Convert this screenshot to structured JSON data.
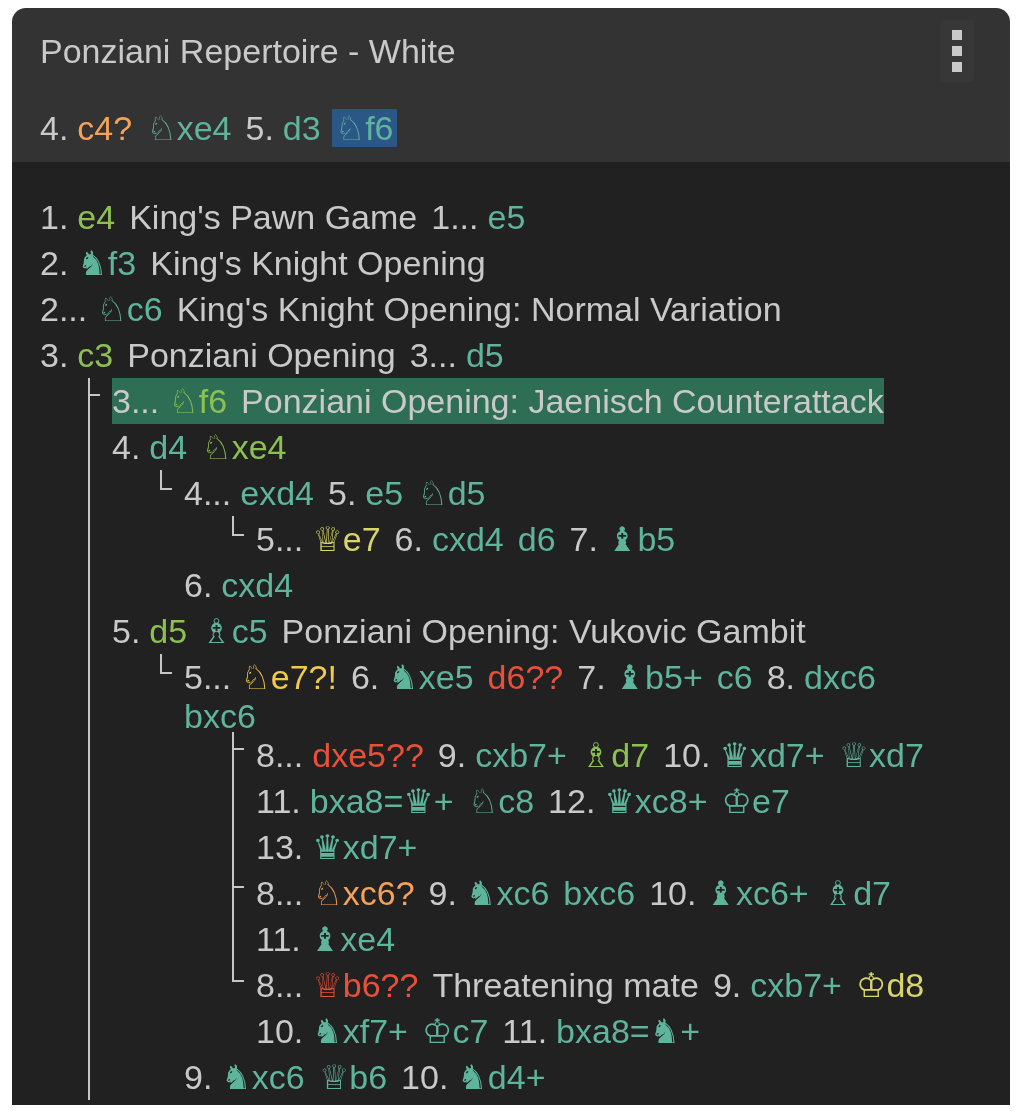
{
  "panel": {
    "title": "Ponziani Repertoire - White"
  },
  "current_line": [
    {
      "number": "4.",
      "move": "c4?",
      "color": "#f4a259",
      "selected": false
    },
    {
      "move": "♘xe4",
      "color": "#5fb49c",
      "selected": false
    },
    {
      "number": "5.",
      "move": "d3",
      "color": "#5fb49c",
      "selected": false
    },
    {
      "move": "♘f6",
      "color": "#5fb49c",
      "selected": true
    }
  ],
  "tree": {
    "blocks": [
      {
        "kind": "line",
        "selected": false,
        "items": [
          {
            "kind": "move",
            "number": "1.",
            "move": "e4",
            "color": "#8cc152"
          },
          {
            "kind": "opening",
            "text": "King's Pawn Game"
          },
          {
            "kind": "move",
            "number": "1...",
            "move": "e5",
            "color": "#5fb49c"
          }
        ]
      },
      {
        "kind": "line",
        "selected": false,
        "items": [
          {
            "kind": "move",
            "number": "2.",
            "move": "♞f3",
            "color": "#5fb49c"
          },
          {
            "kind": "opening",
            "text": "King's Knight Opening"
          }
        ]
      },
      {
        "kind": "line",
        "selected": false,
        "items": [
          {
            "kind": "move",
            "number": "2...",
            "move": "♘c6",
            "color": "#5fb49c"
          },
          {
            "kind": "opening",
            "text": "King's Knight Opening: Normal Variation"
          }
        ]
      },
      {
        "kind": "line",
        "selected": false,
        "items": [
          {
            "kind": "move",
            "number": "3.",
            "move": "c3",
            "color": "#8cc152"
          },
          {
            "kind": "opening",
            "text": "Ponziani Opening"
          },
          {
            "kind": "move",
            "number": "3...",
            "move": "d5",
            "color": "#5fb49c"
          }
        ]
      },
      {
        "kind": "branches",
        "continues_below": true,
        "variations": [
          {
            "blocks": [
              {
                "kind": "line",
                "selected": true,
                "items": [
                  {
                    "kind": "move",
                    "number": "3...",
                    "move": "♘f6",
                    "color": "#8cc152"
                  },
                  {
                    "kind": "opening",
                    "text": "Ponziani Opening: Jaenisch Counterattack"
                  }
                ]
              },
              {
                "kind": "line",
                "selected": false,
                "items": [
                  {
                    "kind": "move",
                    "number": "4.",
                    "move": "d4",
                    "color": "#5fb49c"
                  },
                  {
                    "kind": "move",
                    "move": "♘xe4",
                    "color": "#8cc152"
                  }
                ]
              },
              {
                "kind": "branches",
                "continues_below": false,
                "variations": [
                  {
                    "blocks": [
                      {
                        "kind": "line",
                        "selected": false,
                        "items": [
                          {
                            "kind": "move",
                            "number": "4...",
                            "move": "exd4",
                            "color": "#5fb49c"
                          },
                          {
                            "kind": "move",
                            "number": "5.",
                            "move": "e5",
                            "color": "#5fb49c"
                          },
                          {
                            "kind": "move",
                            "move": "♘d5",
                            "color": "#5fb49c"
                          }
                        ]
                      },
                      {
                        "kind": "branches",
                        "continues_below": false,
                        "variations": [
                          {
                            "blocks": [
                              {
                                "kind": "line",
                                "selected": false,
                                "items": [
                                  {
                                    "kind": "move",
                                    "number": "5...",
                                    "move": "♕e7",
                                    "color": "#d8d66a"
                                  },
                                  {
                                    "kind": "move",
                                    "number": "6.",
                                    "move": "cxd4",
                                    "color": "#5fb49c"
                                  },
                                  {
                                    "kind": "move",
                                    "move": "d6",
                                    "color": "#5fb49c"
                                  },
                                  {
                                    "kind": "move",
                                    "number": "7.",
                                    "move": "♝b5",
                                    "color": "#5fb49c"
                                  }
                                ]
                              }
                            ]
                          }
                        ]
                      },
                      {
                        "kind": "line",
                        "selected": false,
                        "items": [
                          {
                            "kind": "move",
                            "number": "6.",
                            "move": "cxd4",
                            "color": "#5fb49c"
                          }
                        ]
                      }
                    ]
                  }
                ]
              },
              {
                "kind": "line",
                "selected": false,
                "items": [
                  {
                    "kind": "move",
                    "number": "5.",
                    "move": "d5",
                    "color": "#8cc152"
                  },
                  {
                    "kind": "move",
                    "move": "♗c5",
                    "color": "#5fb49c"
                  },
                  {
                    "kind": "opening",
                    "text": "Ponziani Opening: Vukovic Gambit"
                  }
                ]
              },
              {
                "kind": "branches",
                "continues_below": false,
                "variations": [
                  {
                    "blocks": [
                      {
                        "kind": "line",
                        "selected": false,
                        "items": [
                          {
                            "kind": "move",
                            "number": "5...",
                            "move": "♘e7?!",
                            "color": "#f2c94c"
                          },
                          {
                            "kind": "move",
                            "number": "6.",
                            "move": "♞xe5",
                            "color": "#5fb49c"
                          },
                          {
                            "kind": "move",
                            "move": "d6??",
                            "color": "#e8503a"
                          },
                          {
                            "kind": "move",
                            "number": "7.",
                            "move": "♝b5+",
                            "color": "#5fb49c"
                          },
                          {
                            "kind": "move",
                            "move": "c6",
                            "color": "#5fb49c"
                          },
                          {
                            "kind": "move",
                            "number": "8.",
                            "move": "dxc6",
                            "color": "#5fb49c"
                          },
                          {
                            "kind": "move",
                            "move": "bxc6",
                            "color": "#5fb49c"
                          }
                        ]
                      },
                      {
                        "kind": "branches",
                        "continues_below": false,
                        "variations": [
                          {
                            "blocks": [
                              {
                                "kind": "line",
                                "selected": false,
                                "items": [
                                  {
                                    "kind": "move",
                                    "number": "8...",
                                    "move": "dxe5??",
                                    "color": "#e8503a"
                                  },
                                  {
                                    "kind": "move",
                                    "number": "9.",
                                    "move": "cxb7+",
                                    "color": "#5fb49c"
                                  },
                                  {
                                    "kind": "move",
                                    "move": "♗d7",
                                    "color": "#8cc152"
                                  },
                                  {
                                    "kind": "move",
                                    "number": "10.",
                                    "move": "♛xd7+",
                                    "color": "#5fb49c"
                                  },
                                  {
                                    "kind": "move",
                                    "move": "♕xd7",
                                    "color": "#5fb49c"
                                  },
                                  {
                                    "kind": "move",
                                    "number": "11.",
                                    "move": "bxa8=♛+",
                                    "color": "#5fb49c"
                                  },
                                  {
                                    "kind": "move",
                                    "move": "♘c8",
                                    "color": "#5fb49c"
                                  },
                                  {
                                    "kind": "move",
                                    "number": "12.",
                                    "move": "♛xc8+",
                                    "color": "#5fb49c"
                                  },
                                  {
                                    "kind": "move",
                                    "move": "♔e7",
                                    "color": "#5fb49c"
                                  },
                                  {
                                    "kind": "move",
                                    "number": "13.",
                                    "move": "♛xd7+",
                                    "color": "#5fb49c"
                                  }
                                ]
                              }
                            ]
                          },
                          {
                            "blocks": [
                              {
                                "kind": "line",
                                "selected": false,
                                "items": [
                                  {
                                    "kind": "move",
                                    "number": "8...",
                                    "move": "♘xc6?",
                                    "color": "#f4a259"
                                  },
                                  {
                                    "kind": "move",
                                    "number": "9.",
                                    "move": "♞xc6",
                                    "color": "#5fb49c"
                                  },
                                  {
                                    "kind": "move",
                                    "move": "bxc6",
                                    "color": "#5fb49c"
                                  },
                                  {
                                    "kind": "move",
                                    "number": "10.",
                                    "move": "♝xc6+",
                                    "color": "#5fb49c"
                                  },
                                  {
                                    "kind": "move",
                                    "move": "♗d7",
                                    "color": "#5fb49c"
                                  },
                                  {
                                    "kind": "move",
                                    "number": "11.",
                                    "move": "♝xe4",
                                    "color": "#5fb49c"
                                  }
                                ]
                              }
                            ]
                          },
                          {
                            "blocks": [
                              {
                                "kind": "line",
                                "selected": false,
                                "items": [
                                  {
                                    "kind": "move",
                                    "number": "8...",
                                    "move": "♕b6??",
                                    "color": "#e8503a"
                                  },
                                  {
                                    "kind": "comment",
                                    "text": "Threatening mate"
                                  },
                                  {
                                    "kind": "move",
                                    "number": "9.",
                                    "move": "cxb7+",
                                    "color": "#5fb49c"
                                  },
                                  {
                                    "kind": "move",
                                    "move": "♔d8",
                                    "color": "#d8d66a"
                                  },
                                  {
                                    "kind": "move",
                                    "number": "10.",
                                    "move": "♞xf7+",
                                    "color": "#5fb49c"
                                  },
                                  {
                                    "kind": "move",
                                    "move": "♔c7",
                                    "color": "#5fb49c"
                                  },
                                  {
                                    "kind": "move",
                                    "number": "11.",
                                    "move": "bxa8=♞+",
                                    "color": "#5fb49c"
                                  }
                                ]
                              }
                            ]
                          }
                        ]
                      },
                      {
                        "kind": "line",
                        "selected": false,
                        "items": [
                          {
                            "kind": "move",
                            "number": "9.",
                            "move": "♞xc6",
                            "color": "#5fb49c"
                          },
                          {
                            "kind": "move",
                            "move": "♕b6",
                            "color": "#5fb49c"
                          },
                          {
                            "kind": "move",
                            "number": "10.",
                            "move": "♞d4+",
                            "color": "#5fb49c"
                          }
                        ]
                      }
                    ]
                  }
                ]
              }
            ]
          }
        ]
      }
    ]
  }
}
